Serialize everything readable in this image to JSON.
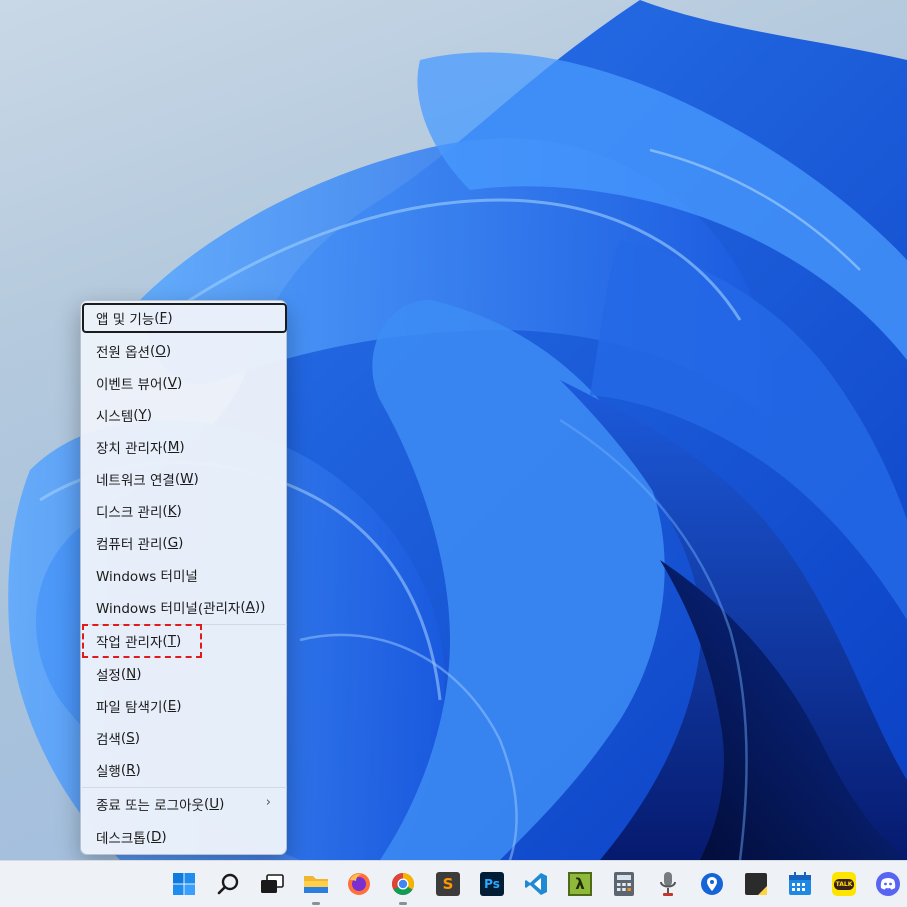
{
  "context_menu": {
    "items": [
      {
        "label": "앱 및 기능",
        "key": "F"
      },
      {
        "label": "전원 옵션",
        "key": "O"
      },
      {
        "label": "이벤트 뷰어",
        "key": "V"
      },
      {
        "label": "시스템",
        "key": "Y"
      },
      {
        "label": "장치 관리자",
        "key": "M"
      },
      {
        "label": "네트워크 연결",
        "key": "W"
      },
      {
        "label": "디스크 관리",
        "key": "K"
      },
      {
        "label": "컴퓨터 관리",
        "key": "G"
      },
      {
        "label": "Windows 터미널",
        "key": ""
      },
      {
        "label": "Windows 터미널(관리자",
        "key": "A"
      },
      {
        "label": "작업 관리자",
        "key": "T"
      },
      {
        "label": "설정",
        "key": "N"
      },
      {
        "label": "파일 탐색기",
        "key": "E"
      },
      {
        "label": "검색",
        "key": "S"
      },
      {
        "label": "실행",
        "key": "R"
      },
      {
        "label": "종료 또는 로그아웃",
        "key": "U"
      },
      {
        "label": "데스크톱",
        "key": "D"
      }
    ],
    "submenu_chevron": "›",
    "highlight_color": "#e01b1b"
  },
  "taskbar": {
    "background": "#eef1f6",
    "icons": [
      {
        "name": "start-icon"
      },
      {
        "name": "search-icon"
      },
      {
        "name": "task-view-icon"
      },
      {
        "name": "file-explorer-icon"
      },
      {
        "name": "firefox-icon"
      },
      {
        "name": "chrome-icon"
      },
      {
        "name": "sublime-text-icon",
        "glyph": "S"
      },
      {
        "name": "photoshop-icon",
        "glyph": "Ps"
      },
      {
        "name": "vscode-icon"
      },
      {
        "name": "lambda-app-icon",
        "glyph": "λ"
      },
      {
        "name": "calculator-icon"
      },
      {
        "name": "microphone-icon"
      },
      {
        "name": "location-pin-icon"
      },
      {
        "name": "sticky-notes-icon"
      },
      {
        "name": "calendar-icon"
      },
      {
        "name": "kakaotalk-icon",
        "glyph": "TALK"
      },
      {
        "name": "discord-icon"
      }
    ]
  }
}
